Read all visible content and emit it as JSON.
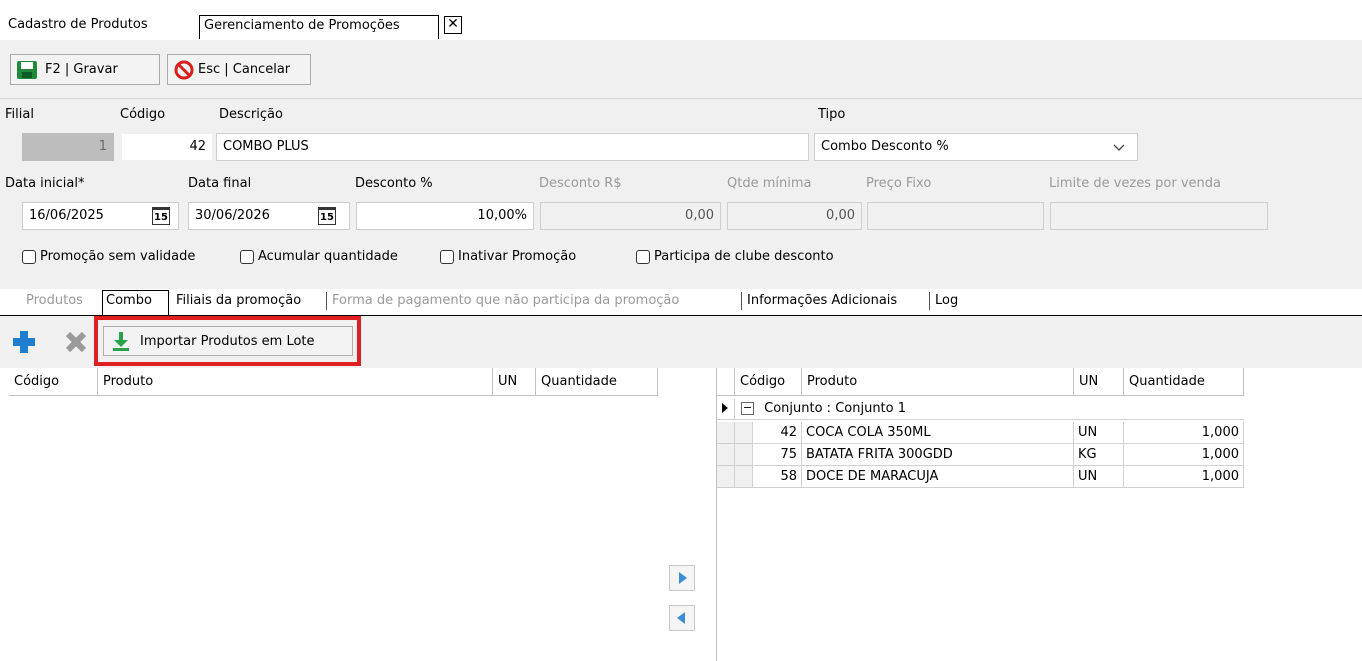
{
  "top_tabs": [
    {
      "label": "Cadastro de Produtos"
    },
    {
      "label": "Gerenciamento de Promoções"
    }
  ],
  "close_glyph": "✕",
  "toolbar": {
    "save_label": "F2 | Gravar",
    "cancel_label": "Esc | Cancelar",
    "save_icon": "floppy-disk-icon",
    "cancel_icon": "no-entry-icon"
  },
  "form": {
    "filial_label": "Filial",
    "filial_value": "1",
    "codigo_label": "Código",
    "codigo_value": "42",
    "descricao_label": "Descrição",
    "descricao_value": "COMBO PLUS",
    "tipo_label": "Tipo",
    "tipo_value": "Combo Desconto %",
    "data_inicial_label": "Data inicial*",
    "data_inicial_value": "16/06/2025",
    "data_final_label": "Data final",
    "data_final_value": "30/06/2026",
    "desconto_pct_label": "Desconto %",
    "desconto_pct_value": "10,00%",
    "desconto_rs_label": "Desconto R$",
    "desconto_rs_value": "0,00",
    "qtde_minima_label": "Qtde mínima",
    "qtde_minima_value": "0,00",
    "preco_fixo_label": "Preço Fixo",
    "preco_fixo_value": "",
    "limite_label": "Limite de vezes por venda",
    "limite_value": "",
    "calendar_glyph": "15"
  },
  "checkboxes": [
    {
      "label": "Promoção sem validade",
      "checked": false
    },
    {
      "label": "Acumular quantidade",
      "checked": false
    },
    {
      "label": "Inativar Promoção",
      "checked": false
    },
    {
      "label": "Participa de clube desconto",
      "checked": false
    }
  ],
  "sub_tabs": [
    {
      "label": "Produtos",
      "state": "disabled"
    },
    {
      "label": "Combo",
      "state": "active"
    },
    {
      "label": "Filiais da promoção",
      "state": "normal"
    },
    {
      "label": "Forma de pagamento que não participa da promoção",
      "state": "disabled"
    },
    {
      "label": "Informações Adicionais",
      "state": "normal"
    },
    {
      "label": "Log",
      "state": "normal"
    }
  ],
  "gridbar": {
    "add_icon": "plus-icon",
    "remove_icon": "x-icon",
    "import_label": "Importar Produtos em Lote",
    "import_icon": "download-arrow-icon",
    "highlight_color": "#e02020"
  },
  "left_grid": {
    "headers": [
      "Código",
      "Produto",
      "UN",
      "Quantidade"
    ]
  },
  "right_grid": {
    "headers": [
      "Código",
      "Produto",
      "UN",
      "Quantidade"
    ],
    "group_toggle": "−",
    "group_label": "Conjunto : Conjunto 1",
    "rows": [
      {
        "codigo": "42",
        "produto": "COCA COLA 350ML",
        "un": "UN",
        "quantidade": "1,000"
      },
      {
        "codigo": "75",
        "produto": "BATATA FRITA 300GDD",
        "un": "KG",
        "quantidade": "1,000"
      },
      {
        "codigo": "58",
        "produto": "DOCE DE MARACUJA",
        "un": "UN",
        "quantidade": "1,000"
      }
    ]
  },
  "colors": {
    "accent_blue": "#1e7fd0",
    "save_green": "#1f8a3a",
    "cancel_red": "#d81e1e"
  }
}
